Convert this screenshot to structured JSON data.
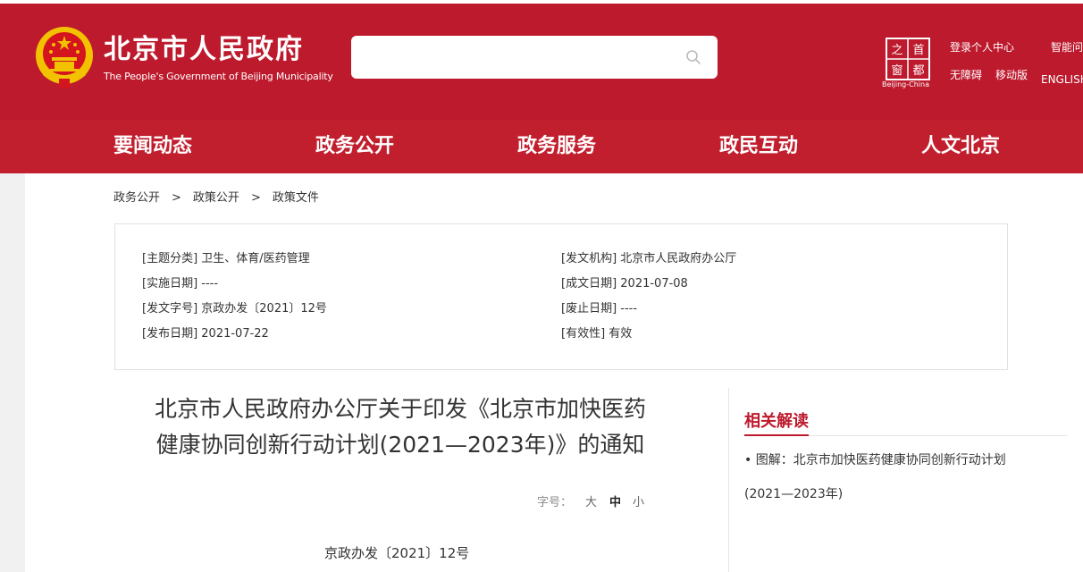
{
  "header": {
    "title": "北京市人民政府",
    "subtitle": "The People's Government of Beijing Municipality",
    "search": {
      "placeholder": ""
    },
    "capital_logo": {
      "chars": [
        "之",
        "首",
        "窗",
        "都"
      ],
      "caption": "Beijing-China"
    },
    "links": {
      "login": "登录个人中心",
      "smart_qa": "智能问",
      "accessible": "无障碍",
      "mobile": "移动版",
      "english": "ENGLISH"
    }
  },
  "nav": {
    "items": [
      "要闻动态",
      "政务公开",
      "政务服务",
      "政民互动",
      "人文北京"
    ]
  },
  "breadcrumb": [
    "政务公开",
    "政策公开",
    "政策文件"
  ],
  "breadcrumb_sep": ">",
  "meta": {
    "topic": "[主题分类] 卫生、体育/医药管理",
    "issuer": "[发文机构] 北京市人民政府办公厅",
    "effective_date": "[实施日期] ----",
    "written_date": "[成文日期] 2021-07-08",
    "doc_number": "[发文字号] 京政办发〔2021〕12号",
    "expiry_date": "[废止日期] ----",
    "publish_date": "[发布日期] 2021-07-22",
    "validity": "[有效性] 有效"
  },
  "article": {
    "title_line1": "北京市人民政府办公厅关于印发《北京市加快医药",
    "title_line2": "健康协同创新行动计划(2021—2023年)》的通知",
    "font_label": "字号：",
    "font_options": [
      "大",
      "中",
      "小"
    ],
    "font_selected": "中",
    "doc_no": "京政办发〔2021〕12号"
  },
  "related": {
    "title": "相关解读",
    "items": [
      "图解：北京市加快医药健康协同创新行动计划(2021—2023年)"
    ]
  },
  "colors": {
    "brand_red": "#bd1a2d",
    "nav_red": "#c21f2e",
    "emblem_gold": "#f2c200"
  },
  "icons": [
    "national-emblem-icon",
    "search-icon",
    "capital-window-logo-icon"
  ]
}
